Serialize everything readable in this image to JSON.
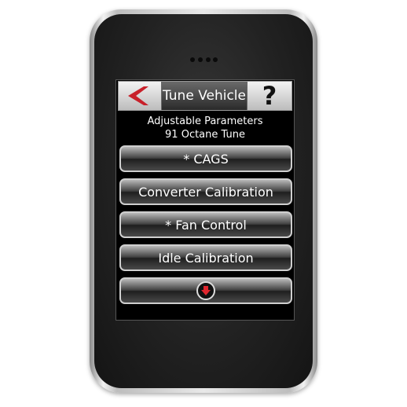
{
  "header": {
    "title": "Tune Vehicle",
    "help_label": "?"
  },
  "subtitle": {
    "line1": "Adjustable Parameters",
    "line2": "91 Octane Tune"
  },
  "menu": {
    "items": [
      {
        "label": "* CAGS"
      },
      {
        "label": "Converter Calibration"
      },
      {
        "label": "* Fan Control"
      },
      {
        "label": "Idle Calibration"
      }
    ]
  },
  "icons": {
    "back": "back-chevron-icon",
    "help": "question-mark-icon",
    "scroll_down": "arrow-down-icon"
  },
  "colors": {
    "accent_red": "#c8202a",
    "screen_bg": "#000000",
    "text": "#ffffff"
  }
}
